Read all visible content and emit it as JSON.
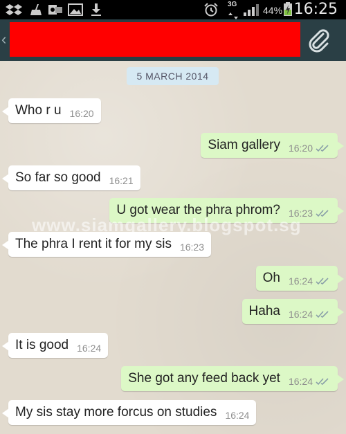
{
  "status_bar": {
    "battery_percent": "44%",
    "network": "3G",
    "time": "16:25",
    "icons": [
      "dropbox-icon",
      "cleaner-icon",
      "outlook-icon",
      "gallery-icon",
      "download-icon",
      "alarm-icon",
      "network-3g-icon",
      "signal-icon",
      "battery-icon"
    ]
  },
  "header": {
    "back_glyph": "‹",
    "icons": [
      "back-icon",
      "attach-paperclip-icon"
    ]
  },
  "chat": {
    "date": "5 MARCH 2014",
    "watermark": "www.siamgallery.blogspot.sg",
    "messages": [
      {
        "dir": "in",
        "text": "Who r u",
        "time": "16:20"
      },
      {
        "dir": "out",
        "text": "Siam gallery",
        "time": "16:20"
      },
      {
        "dir": "in",
        "text": "So far so good",
        "time": "16:21"
      },
      {
        "dir": "out",
        "text": "U got wear the phra phrom?",
        "time": "16:23"
      },
      {
        "dir": "in",
        "text": "The phra I rent it for my sis",
        "time": "16:23"
      },
      {
        "dir": "out",
        "text": "Oh",
        "time": "16:24"
      },
      {
        "dir": "out",
        "text": "Haha",
        "time": "16:24"
      },
      {
        "dir": "in",
        "text": "It is good",
        "time": "16:24"
      },
      {
        "dir": "out",
        "text": "She got any feed back yet",
        "time": "16:24"
      },
      {
        "dir": "in",
        "text": "My sis stay more forcus on studies",
        "time": "16:24"
      }
    ]
  },
  "colors": {
    "incoming_bubble": "#ffffff",
    "outgoing_bubble": "#dcf8c6",
    "header": "#2a3f45",
    "date_pill": "#d6e9f3",
    "redaction": "#ff0000"
  }
}
